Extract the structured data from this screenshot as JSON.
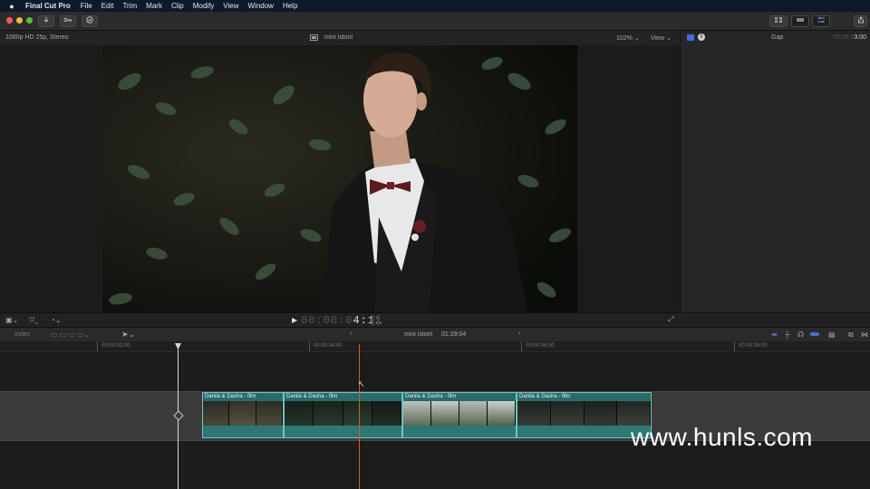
{
  "menubar": {
    "apple": "",
    "app_name": "Final Cut Pro",
    "items": [
      "File",
      "Edit",
      "Trim",
      "Mark",
      "Clip",
      "Modify",
      "View",
      "Window",
      "Help"
    ]
  },
  "toolbar": {
    "import_icon": "download-icon",
    "keywords_icon": "key-icon",
    "background_tasks_icon": "checkmark-circle-icon",
    "share_icon": "share-icon"
  },
  "viewer": {
    "format": "1080p HD 25p, Stereo",
    "project_name": "mini istorii",
    "zoom": "102%",
    "view_menu": "View",
    "timecode_dim": "00:00:0",
    "timecode_bright": "4:11"
  },
  "inspector": {
    "label": "Gap",
    "duration_dim": "00:00:0",
    "duration_bright": "3:00"
  },
  "timeline": {
    "index_label": "Index",
    "project_name": "mini istorii",
    "project_duration": "01:29:04",
    "ruler": [
      "00:00:02:00",
      "00:00:04:00",
      "00:00:06:00",
      "00:00:08:00"
    ],
    "clips": [
      {
        "label": "Danila & Dasha - film"
      },
      {
        "label": "Danila & Dasha - film"
      },
      {
        "label": "Danila & Dasha - film"
      },
      {
        "label": "Danila & Dasha - film"
      }
    ]
  },
  "watermark": "www.hunls.com",
  "colors": {
    "clip": "#2b6a68",
    "clip_border": "#6cc7c0",
    "playhead": "#c8651f",
    "accent": "#4a6ae0"
  }
}
